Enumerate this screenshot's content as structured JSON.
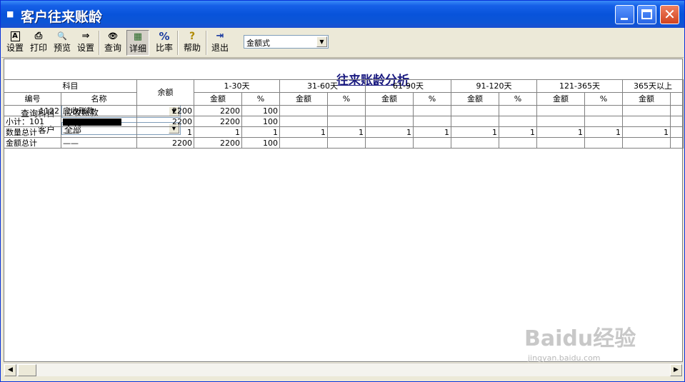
{
  "window": {
    "title": "客户往来账龄"
  },
  "toolbar": {
    "buttons": [
      {
        "icon": "A",
        "label": "设置"
      },
      {
        "icon": "⎙",
        "label": "打印"
      },
      {
        "icon": "🔍",
        "label": "预览"
      },
      {
        "icon": "⇒",
        "label": "设置"
      },
      {
        "icon": "👁",
        "label": "查询"
      },
      {
        "icon": "▦",
        "label": "详细"
      },
      {
        "icon": "%",
        "label": "比率"
      },
      {
        "icon": "?",
        "label": "帮助"
      },
      {
        "icon": "⇥",
        "label": "退出"
      }
    ],
    "mode_select": {
      "value": "金额式"
    }
  },
  "report": {
    "title": "往来账龄分析",
    "filters": {
      "subject_label": "查询科目",
      "subject_value": "应收账款",
      "customer_label": "客户",
      "customer_value": "全部"
    }
  },
  "table": {
    "header1": {
      "subject": "科目",
      "balance": "余额",
      "periods": [
        "1-30天",
        "31-60天",
        "61-90天",
        "91-120天",
        "121-365天",
        "365天以上"
      ]
    },
    "header2": {
      "code": "编号",
      "name": "名称",
      "amount": "金额",
      "percent": "%"
    },
    "rows": [
      {
        "code": "1122",
        "name": "应收账款",
        "balance": "2200",
        "cells": [
          "2200",
          "100",
          "",
          "",
          "",
          "",
          "",
          "",
          "",
          "",
          "",
          ""
        ]
      },
      {
        "code": "小计：101",
        "name": "",
        "balance": "2200",
        "cells": [
          "2200",
          "100",
          "",
          "",
          "",
          "",
          "",
          "",
          "",
          "",
          "",
          ""
        ]
      },
      {
        "code": "数量总计",
        "name": "——",
        "balance": "1",
        "cells": [
          "1",
          "1",
          "1",
          "1",
          "1",
          "1",
          "1",
          "1",
          "1",
          "1",
          "1",
          ""
        ]
      },
      {
        "code": "金额总计",
        "name": "——",
        "balance": "2200",
        "cells": [
          "2200",
          "100",
          "",
          "",
          "",
          "",
          "",
          "",
          "",
          "",
          "",
          ""
        ]
      }
    ]
  },
  "watermark": {
    "text": "Baidu经验",
    "sub": "jingyan.baidu.com"
  },
  "colors": {
    "titlebar": "#0853da",
    "report_title": "#1a1a80"
  }
}
